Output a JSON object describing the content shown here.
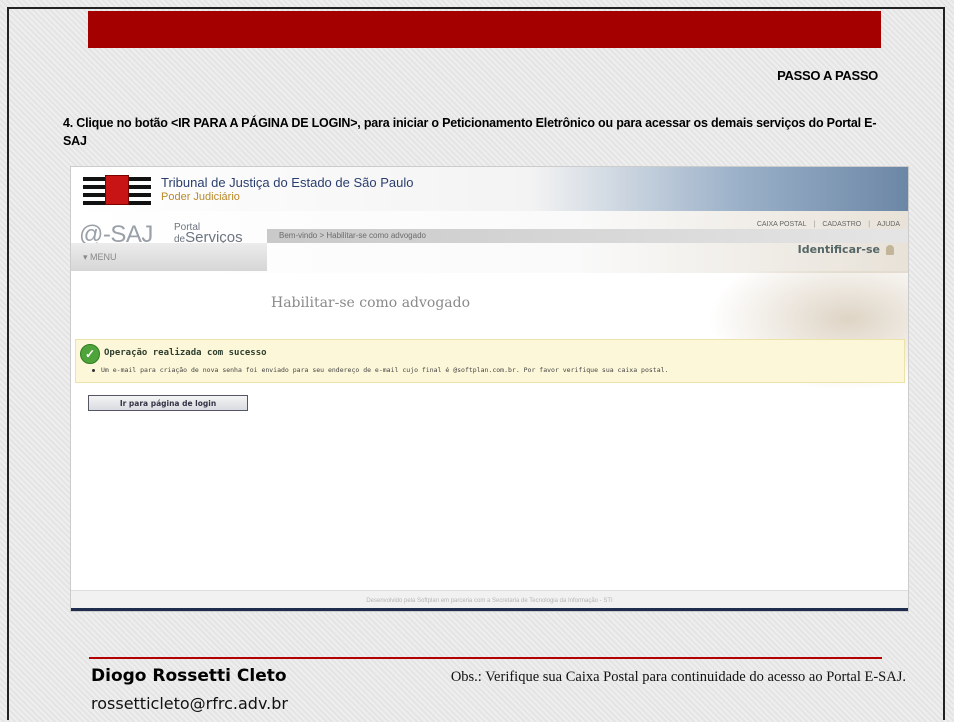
{
  "slide": {
    "step_label": "PASSO A PASSO",
    "instruction": "4. Clique no botão <IR PARA A PÁGINA DE LOGIN>, para iniciar o Peticionamento Eletrônico ou  para acessar os demais serviços do Portal E-SAJ",
    "colors": {
      "accent": "#a50000",
      "background": "#e9e9e9"
    }
  },
  "screenshot": {
    "tj_title": "Tribunal de Justiça do Estado de São Paulo",
    "tj_subtitle": "Poder Judiciário",
    "esaj_logo": "@-SAJ",
    "portal_small": "Portal",
    "portal_de": "de",
    "portal_big": "Serviços",
    "top_links": [
      "CAIXA POSTAL",
      "CADASTRO",
      "AJUDA"
    ],
    "identify": "Identificar-se",
    "breadcrumb": "Bem-vindo > Habilitar-se como advogado",
    "menu": "MENU",
    "page_heading": "Habilitar-se como advogado",
    "success_title": "Operação realizada com sucesso",
    "success_message": "Um e-mail para criação de nova senha foi enviado para seu endereço de e-mail cujo final é @softplan.com.br. Por favor verifique sua caixa postal.",
    "login_button": "Ir para página de login",
    "footer": "Desenvolvido pela Softplan em parceria com a Secretaria de Tecnologia da Informação - STI"
  },
  "author": {
    "name": "Diogo Rossetti Cleto",
    "email": "rossetticleto@rfrc.adv.br"
  },
  "note": "Obs.: Verifique sua Caixa Postal para continuidade do acesso ao Portal E-SAJ."
}
